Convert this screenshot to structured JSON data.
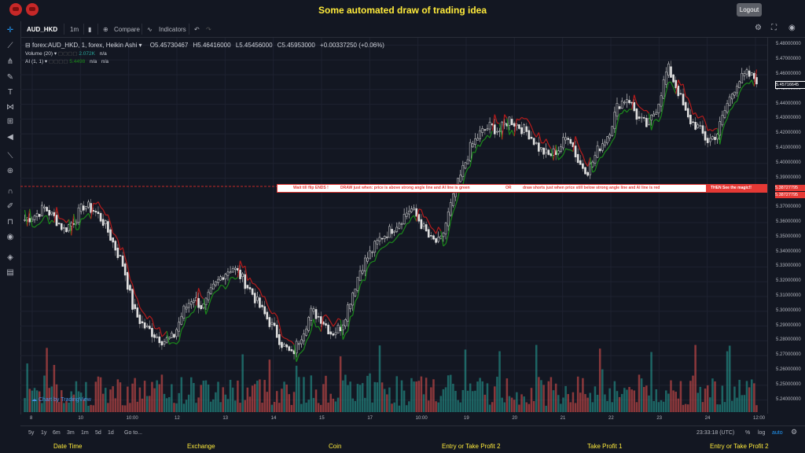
{
  "header": {
    "title": "Some automated draw of trading idea",
    "logout_label": "Logout"
  },
  "toolbar": {
    "symbol": "AUD_HKD",
    "interval": "1m",
    "compare_label": "Compare",
    "indicators_label": "Indicators"
  },
  "legend": {
    "main": "forex:AUD_HKD, 1, forex, Heikin Ashi",
    "open": "O5.45730467",
    "high": "H5.46416000",
    "low": "L5.45456000",
    "close": "C5.45953000",
    "change": "+0.00337250 (+0.06%)",
    "volume_label": "Volume (20)",
    "volume_value": "2.072K",
    "volume_na": "n/a",
    "ai_label": "AI (1, 1)",
    "ai_value": "5.4498",
    "ai_na1": "n/a",
    "ai_na2": "n/a"
  },
  "banner": {
    "part1": "Wait till flip ENDS  !",
    "part2": "DRAW just when:  price is above strong angle line and AI line is green",
    "part3": "OR",
    "part4": "draw shorts just when price still below strong angle line and AI line is red",
    "right": "THEN See the magic!!"
  },
  "price_axis": {
    "labels": [
      "5.48000000",
      "5.47000000",
      "5.46000000",
      "5.45000000",
      "5.44000000",
      "5.43000000",
      "5.42000000",
      "5.41000000",
      "5.40000000",
      "5.39000000",
      "5.37000000",
      "5.36000000",
      "5.35000000",
      "5.34000000",
      "5.33000000",
      "5.32000000",
      "5.31000000",
      "5.30000000",
      "5.29000000",
      "5.28000000",
      "5.27000000",
      "5.26000000",
      "5.25000000",
      "5.24000000"
    ],
    "current_price": "5.45716645",
    "tag1": "5.38727795",
    "tag2": "5.38727795"
  },
  "time_axis": {
    "labels": [
      "8",
      "10",
      "10:00",
      "12",
      "13",
      "14",
      "15",
      "17",
      "10:00",
      "19",
      "20",
      "21",
      "22",
      "23",
      "24",
      "12:00"
    ]
  },
  "bottom": {
    "ranges": [
      "5y",
      "1y",
      "6m",
      "3m",
      "1m",
      "5d",
      "1d"
    ],
    "goto": "Go to...",
    "clock": "23:33:18 (UTC)",
    "percent": "%",
    "log": "log",
    "auto": "auto"
  },
  "watermark": "Chart by TradingView",
  "footer": {
    "items": [
      "Date Time",
      "Exchange",
      "Coin",
      "Entry or Take Profit 2",
      "Take Profit 1",
      "Entry or Take Profit 2"
    ]
  },
  "colors": {
    "background": "#131722",
    "title": "#ffeb3b",
    "up": "#26a69a",
    "down": "#ef5350",
    "ai_green": "#1b8a1b",
    "ai_red": "#b71c1c",
    "banner_red": "#e53935"
  },
  "chart_data": {
    "type": "line",
    "series": [
      {
        "name": "forex:AUD_HKD, 1, forex, Heikin Ashi",
        "values": [
          5.362,
          5.365,
          5.37,
          5.363,
          5.355,
          5.362,
          5.372,
          5.368,
          5.36,
          5.345,
          5.33,
          5.3,
          5.29,
          5.285,
          5.28,
          5.282,
          5.3,
          5.31,
          5.302,
          5.315,
          5.325,
          5.33,
          5.322,
          5.312,
          5.3,
          5.29,
          5.278,
          5.27,
          5.285,
          5.3,
          5.295,
          5.285,
          5.29,
          5.31,
          5.33,
          5.34,
          5.35,
          5.355,
          5.362,
          5.37,
          5.36,
          5.348,
          5.346,
          5.37,
          5.39,
          5.41,
          5.42,
          5.425,
          5.422,
          5.43,
          5.425,
          5.42,
          5.41,
          5.405,
          5.41,
          5.42,
          5.4,
          5.395,
          5.41,
          5.42,
          5.44,
          5.445,
          5.43,
          5.425,
          5.44,
          5.465,
          5.45,
          5.43,
          5.425,
          5.415,
          5.42,
          5.44,
          5.455,
          5.46,
          5.457
        ]
      }
    ],
    "ylim": [
      5.235,
      5.485
    ]
  }
}
